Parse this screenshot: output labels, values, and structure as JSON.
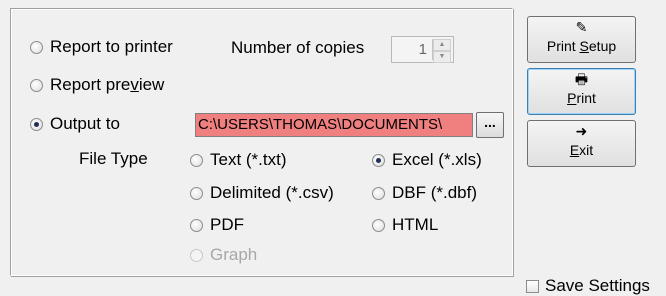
{
  "output_group": {
    "report_to_printer": "Report to printer",
    "report_preview": "Report preview",
    "output_to": "Output to",
    "output_path": "C:\\USERS\\THOMAS\\DOCUMENTS\\",
    "browse_label": "...",
    "copies_label": "Number of copies",
    "copies_value": "1",
    "selected_destination": "Output to"
  },
  "file_type": {
    "label": "File Type",
    "options": {
      "txt": "Text (*.txt)",
      "xls": "Excel (*.xls)",
      "csv": "Delimited (*.csv)",
      "dbf": "DBF (*.dbf)",
      "pdf": "PDF",
      "html": "HTML",
      "graph": "Graph"
    },
    "selected": "Excel (*.xls)"
  },
  "buttons": {
    "print_setup": "Print Setup",
    "print": "Print",
    "exit": "Exit"
  },
  "save_settings": {
    "label": "Save Settings",
    "checked": false
  },
  "icons": {
    "print_setup": "printer-settings-icon",
    "print": "printer-icon",
    "exit": "exit-door-icon"
  }
}
